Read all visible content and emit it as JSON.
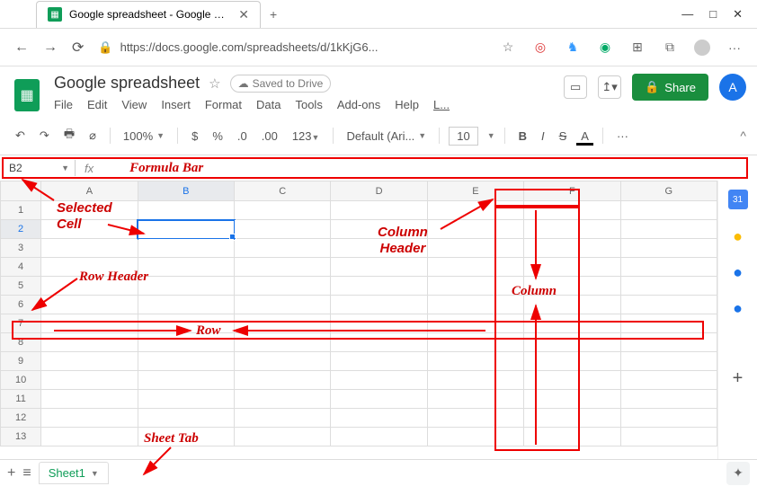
{
  "browser": {
    "tab_title": "Google spreadsheet - Google She",
    "url_display": "https://docs.google.com/spreadsheets/d/1kKjG6...",
    "win_min": "—",
    "win_max": "□",
    "win_close": "✕",
    "new_tab": "+"
  },
  "doc": {
    "title": "Google spreadsheet",
    "saved_text": "Saved to Drive",
    "share_label": "Share",
    "avatar_letter": "A"
  },
  "menus": [
    "File",
    "Edit",
    "View",
    "Insert",
    "Format",
    "Data",
    "Tools",
    "Add-ons",
    "Help",
    "L..."
  ],
  "toolbar": {
    "zoom": "100%",
    "currency": "$",
    "percent": "%",
    "dec_dec": ".0",
    "inc_dec": ".00",
    "num_fmt": "123",
    "font": "Default (Ari...",
    "size": "10",
    "bold": "B",
    "italic": "I",
    "strike": "S",
    "textcolor": "A",
    "more": "···",
    "collapse": "^"
  },
  "formula": {
    "cell_ref": "B2",
    "fx": "fx"
  },
  "columns": [
    "A",
    "B",
    "C",
    "D",
    "E",
    "F",
    "G"
  ],
  "rows": [
    "1",
    "2",
    "3",
    "4",
    "5",
    "6",
    "7",
    "8",
    "9",
    "10",
    "11",
    "12",
    "13"
  ],
  "selected_col": 1,
  "selected_row": 1,
  "sheet_tabs": {
    "add": "+",
    "menu": "≡",
    "active": "Sheet1"
  },
  "annotations": {
    "formula_bar": "Formula Bar",
    "selected_cell": "Selected",
    "cell_word": "Cell",
    "row_header": "Row Header",
    "column_header": "Column",
    "header_word": "Header",
    "column": "Column",
    "row": "Row",
    "sheet_tab": "Sheet Tab"
  },
  "side_rail": {
    "cal": "31",
    "keep": "●",
    "tasks": "●",
    "contacts": "●",
    "add": "+"
  }
}
